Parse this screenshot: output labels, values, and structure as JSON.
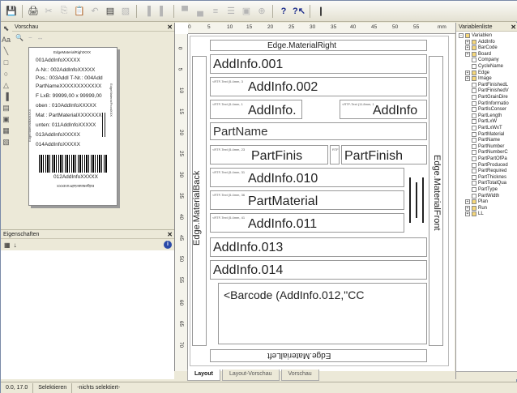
{
  "panels": {
    "preview_title": "Vorschau",
    "props_title": "Eigenschaften",
    "varlist_title": "Variablenliste"
  },
  "label_preview": {
    "header": "EdgeMaterialRightXXX",
    "lines": [
      "001AddInfoXXXXX",
      "A-Nr.:  002AddInfoXXXXX",
      "Pos.:   003AddI  T-Nr.:  004Add",
      "PartNameXXXXXXXXXXXX",
      "F LxB:  99999,00 x 99999,00",
      "oben :  010AddInfoXXXXX",
      "Mat  :  PartMaterialXXXXXXX",
      "unten:  011AddInfoXXXXX",
      "013AddInfoXXXXX",
      "014AddInfoXXXXX"
    ],
    "barcode_text": "012AddInfoXXXXX",
    "footer": "EdgeMaterialFrontXXX",
    "left_vertical": "EdgeMaterialBackXXX",
    "right_vertical": "EdgeMaterialFrontXXX"
  },
  "ruler": {
    "h_ticks": [
      "0",
      "5",
      "10",
      "15",
      "20",
      "25",
      "30",
      "35",
      "40",
      "45",
      "50",
      "55",
      "mm"
    ],
    "v_ticks": [
      "0",
      "5",
      "10",
      "15",
      "20",
      "25",
      "30",
      "35",
      "40",
      "45",
      "50",
      "55",
      "60",
      "65",
      "70"
    ],
    "unit": "mm"
  },
  "design": {
    "edge_top": "Edge.MaterialRight",
    "edge_bottom": "Edge.MaterialLeft",
    "edge_left": "Edge.MaterialBack",
    "edge_right": "Edge.MaterialFront",
    "rtf_label": "<RTF-Text (5.4mm, 3",
    "rtf_label2": "<RTF-Text (5.4mm, 3",
    "rtf_label3": "<RTF-Text (5.4mm, 1",
    "rtf_label4": "<RTF-Text (11.8mm, 1",
    "rtf_label5": "<RTF-Text (5.4mm, 23",
    "rtf_label6": "RTF",
    "rtf_label7": "<RTF-Text (5.4mm, 31",
    "rtf_label8": "<RTF-Text (5.4mm, 36",
    "rtf_label9": "<RTF-Text (5.4mm, 41",
    "addinfo001": "AddInfo.001",
    "addinfo002": "AddInfo.002",
    "addinfo_a": "AddInfo.",
    "addinfo_b": "AddInfo",
    "partname": "PartName",
    "partfinis": "PartFinis",
    "partfinish": "PartFinish",
    "addinfo010": "AddInfo.010",
    "partmaterial": "PartMaterial",
    "addinfo011": "AddInfo.011",
    "addinfo013": "AddInfo.013",
    "addinfo014": "AddInfo.014",
    "barcode_expr": "<Barcode (AddInfo.012,\"CC"
  },
  "tabs": [
    "Layout",
    "Layout-Vorschau",
    "Vorschau"
  ],
  "variables": [
    {
      "label": "Variablen",
      "level": 0,
      "exp": "-"
    },
    {
      "label": "AddInfo",
      "level": 1,
      "exp": "+"
    },
    {
      "label": "BarCode",
      "level": 1,
      "exp": "+"
    },
    {
      "label": "Board",
      "level": 1,
      "exp": "+"
    },
    {
      "label": "Company",
      "level": 1,
      "exp": ""
    },
    {
      "label": "CycleName",
      "level": 1,
      "exp": ""
    },
    {
      "label": "Edge",
      "level": 1,
      "exp": "+"
    },
    {
      "label": "Image",
      "level": 1,
      "exp": "+"
    },
    {
      "label": "PartFinishedL",
      "level": 1,
      "exp": ""
    },
    {
      "label": "PartFinishedV",
      "level": 1,
      "exp": ""
    },
    {
      "label": "PartGrainDire",
      "level": 1,
      "exp": ""
    },
    {
      "label": "PartInformatio",
      "level": 1,
      "exp": ""
    },
    {
      "label": "PartIsConser",
      "level": 1,
      "exp": ""
    },
    {
      "label": "PartLength",
      "level": 1,
      "exp": ""
    },
    {
      "label": "PartLxW",
      "level": 1,
      "exp": ""
    },
    {
      "label": "PartLxWxT",
      "level": 1,
      "exp": ""
    },
    {
      "label": "PartMaterial",
      "level": 1,
      "exp": ""
    },
    {
      "label": "PartName",
      "level": 1,
      "exp": ""
    },
    {
      "label": "PartNumber",
      "level": 1,
      "exp": ""
    },
    {
      "label": "PartNumberC",
      "level": 1,
      "exp": ""
    },
    {
      "label": "PartPartOfPa",
      "level": 1,
      "exp": ""
    },
    {
      "label": "PartProduced",
      "level": 1,
      "exp": ""
    },
    {
      "label": "PartRequired",
      "level": 1,
      "exp": ""
    },
    {
      "label": "PartThicknes",
      "level": 1,
      "exp": ""
    },
    {
      "label": "PartTotalQua",
      "level": 1,
      "exp": ""
    },
    {
      "label": "PartType",
      "level": 1,
      "exp": ""
    },
    {
      "label": "PartWidth",
      "level": 1,
      "exp": ""
    },
    {
      "label": "Plan",
      "level": 1,
      "exp": "+"
    },
    {
      "label": "Run",
      "level": 1,
      "exp": "+"
    },
    {
      "label": "LL",
      "level": 1,
      "exp": "+"
    }
  ],
  "status": {
    "coords": "0.0, 17.0",
    "mode": "Selektieren",
    "selection": "-nichts selektiert-"
  },
  "toolbar_help": "?",
  "toolbar_context_help": "?"
}
